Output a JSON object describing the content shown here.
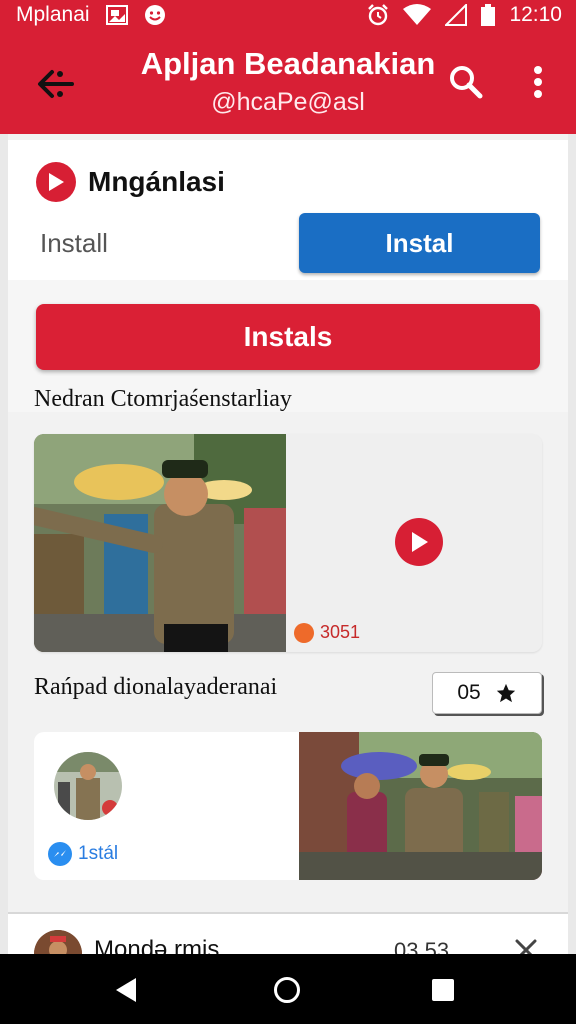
{
  "status_bar": {
    "carrier": "Mplanai",
    "time": "12:10",
    "icons": [
      "image-icon",
      "emoji-icon",
      "alarm-icon",
      "wifi-icon",
      "signal-icon",
      "battery-icon"
    ]
  },
  "app_bar": {
    "title": "Apljan Beadanakian",
    "subtitle": "@hcaPe@asl",
    "icons": [
      "share-back-icon",
      "search-icon",
      "more-vert-icon"
    ]
  },
  "section": {
    "label": "Mngánlasi",
    "install_text": "Install",
    "install_button": "Instal",
    "installs_button": "Instals"
  },
  "feed": {
    "heading_1": "Nedran Ctomrjaśenstarliay",
    "views_count": "3051",
    "heading_2": "Rańpad dionalayaderanai",
    "rating_value": "05",
    "badge_text": "1stál"
  },
  "list_row": {
    "name": "Mondə rmis",
    "time": "03.53"
  },
  "colors": {
    "brand_red": "#d71f34",
    "button_blue": "#1a6ec4",
    "nav_black": "#000000"
  }
}
